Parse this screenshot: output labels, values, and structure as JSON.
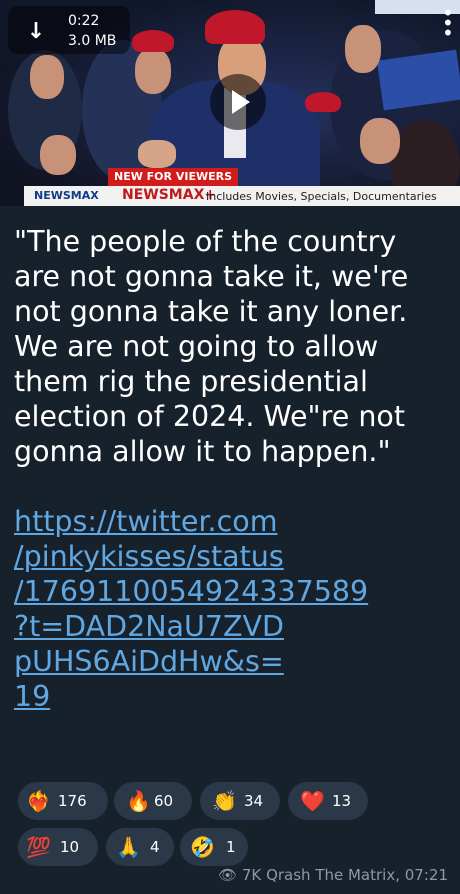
{
  "video": {
    "duration": "0:22",
    "size": "3.0 MB",
    "banner_label": "NEW FOR VIEWERS",
    "brand_left": "NEWSMAX",
    "brand_right": "NEWSMAX+",
    "banner_text": "Includes Movies, Specials, Documentaries"
  },
  "message": {
    "quote": "\"The people of the country are not gonna take it, we're not gonna take it any loner. We are not going to allow them rig the presidential election of 2024. We\"re not gonna allow it to happen.\"",
    "link_lines": [
      "https://twitter.com",
      "/pinkykisses/status",
      "/1769110054924337589",
      "?t=DAD2NaU7ZVD",
      "pUHS6AiDdHw&s=",
      "19"
    ]
  },
  "reactions": [
    {
      "emoji": "❤️‍🔥",
      "count": "176"
    },
    {
      "emoji": "🔥",
      "count": "60"
    },
    {
      "emoji": "👏",
      "count": "34"
    },
    {
      "emoji": "❤️",
      "count": "13"
    },
    {
      "emoji": "💯",
      "count": "10"
    },
    {
      "emoji": "🙏",
      "count": "4"
    },
    {
      "emoji": "🤣",
      "count": "1"
    }
  ],
  "footer": {
    "views": "7K",
    "channel": "Qrash The Matrix",
    "time": "07:21"
  }
}
